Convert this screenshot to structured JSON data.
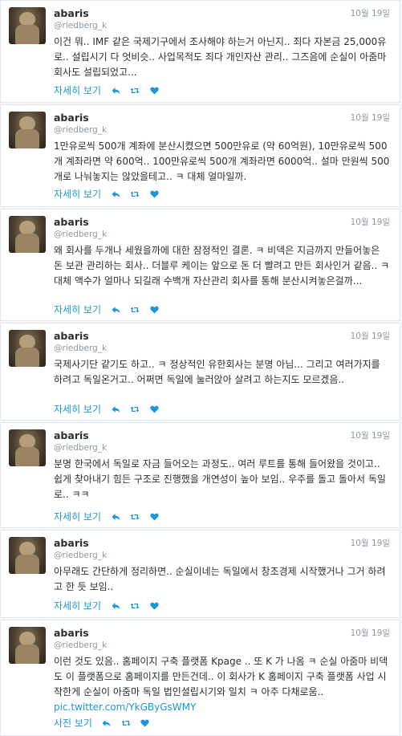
{
  "tweets": [
    {
      "name": "abaris",
      "handle": "@riedberg_k",
      "date": "10월 19일",
      "text": "이건 뭐.. IMF 같은 국제기구에서 조사해야 하는거 아닌지.. 죄다 자본금 25,000유로.. 설립시기 다 엇비슷.. 사업목적도 죄다 개인자산 관리.. 그즈음에 순실이 아줌마 회사도 설립되었고...",
      "more": "자세히 보기"
    },
    {
      "name": "abaris",
      "handle": "@riedberg_k",
      "date": "10월 19일",
      "text": "1만유로씩 500개 계좌에 분산시켰으면 500만유로 (약 60억원), 10만유로씩 500개 계좌라면 약 600억.. 100만유로씩 500개 계좌라면 6000억.. 설마 만원씩 500개로 나눠놓지는 않았을테고.. ㅋ 대체 얼마일까.",
      "more": "자세히 보기"
    },
    {
      "name": "abaris",
      "handle": "@riedberg_k",
      "date": "10월 19일",
      "text": "왜 회사를 두개나 세웠을까에 대한 잠정적인 결론. ㅋ 비덱은 지금까지 만들어놓은 돈 보관 관리하는 회사.. 더블루 케이는 앞으로 돈 더 빨려고 만든 회사인거 같음.. ㅋ 대체 액수가 얼마나 되길래 수백개 자산관리 회사를 통해 분산시켜놓은걸까...",
      "more": "자세히 보기"
    },
    {
      "name": "abaris",
      "handle": "@riedberg_k",
      "date": "10월 19일",
      "text": "국제사기단 같기도 하고.. ㅋ 정상적인 유한회사는 분명 아님... 그리고 여러가지를 하려고 독일온거고.. 어쩌면 독일에 눌러앉아 살려고 하는지도 모르겠음..",
      "more": "자세히 보기"
    },
    {
      "name": "abaris",
      "handle": "@riedberg_k",
      "date": "10월 19일",
      "text": "분명 한국에서 독일로 자금 들어오는 과정도.. 여러 루트를 통해 들어왔을 것이고.. 쉽게 찾아내기 힘든 구조로 진행했을 개연성이 높아 보임.. 우주를 돌고 돌아서 독일로.. ㅋㅋ",
      "more": "자세히 보기"
    },
    {
      "name": "abaris",
      "handle": "@riedberg_k",
      "date": "10월 19일",
      "text": "아무래도 간단하게 정리하면.. 순실이네는 독일에서 창조경제 시작했거나 그거 하려고 한 듯 보임..",
      "more": "자세히 보기"
    },
    {
      "name": "abaris",
      "handle": "@riedberg_k",
      "date": "10월 19일",
      "text": "이런 것도 있음.. 홈페이지 구축 플랫폼 Kpage .. 또 K 가 나옴 ㅋ 순실 아줌마 비덱도 이 플랫폼으로 홈페이지를 만든건데.. 이 회사가 K 홈페이지 구축 플랫폼 사업 시작한게 순실이 아줌마 독일 법인설립시기와 일치 ㅋ 아주 다채로움..",
      "link": "pic.twitter.com/YkGByGsWMY",
      "more": "사진 보기"
    }
  ],
  "icons": {
    "reply": "reply-icon",
    "retweet": "retweet-icon",
    "like": "heart-icon"
  },
  "colors": {
    "link": "#1b95e0",
    "text": "#292f33",
    "muted": "#8899a6",
    "border": "#e1e8ed",
    "background": "#f5f8fa"
  }
}
